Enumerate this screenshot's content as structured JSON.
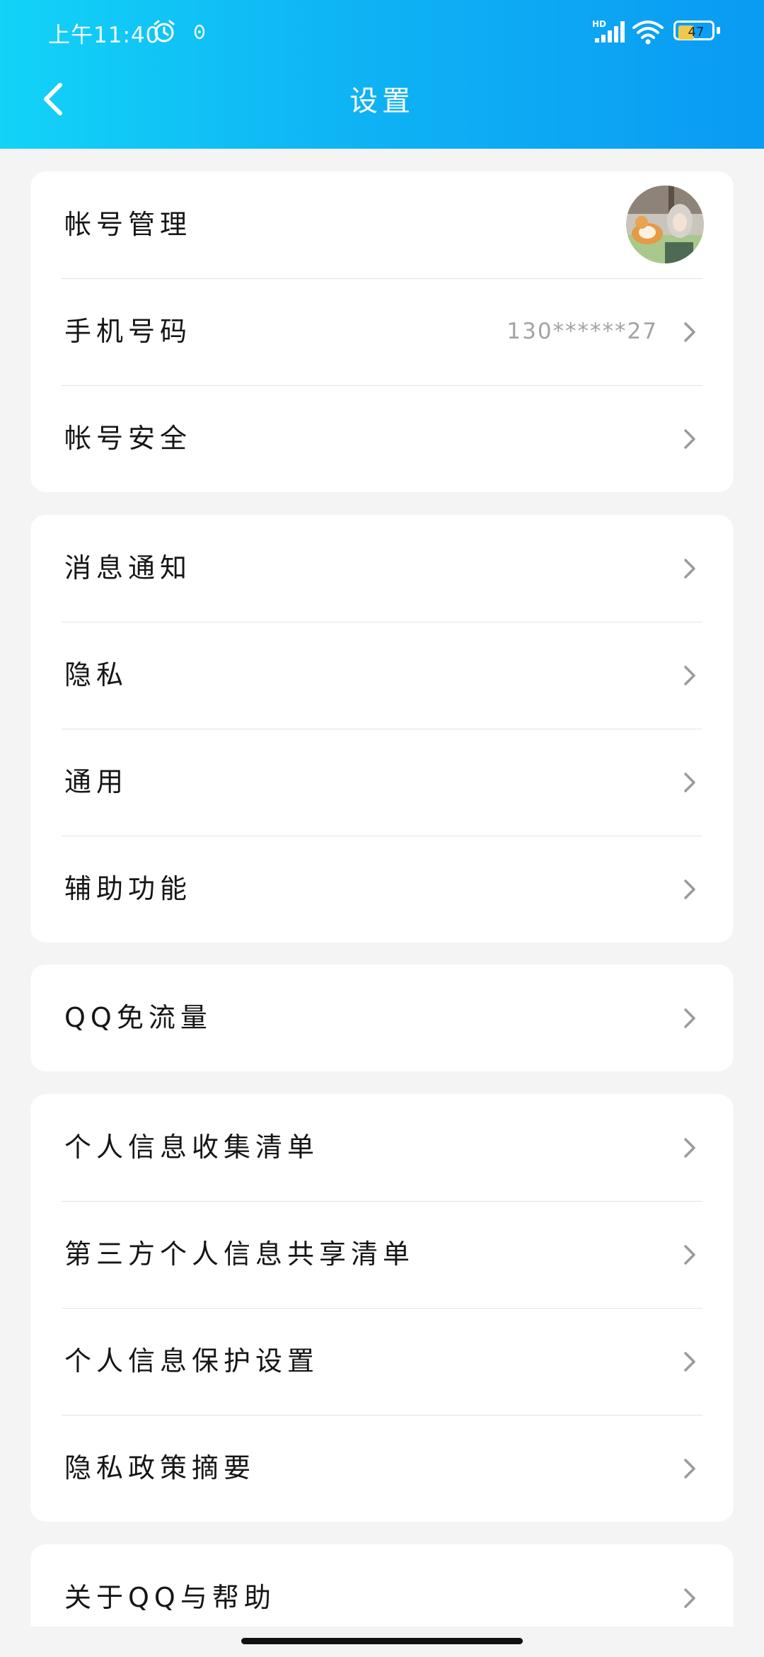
{
  "statusbar": {
    "time": "上午11:40",
    "battery_level": "47",
    "battery_percent": 47,
    "network_label": "HD"
  },
  "header": {
    "title": "设置",
    "back_icon": "chevron-left-icon"
  },
  "sections": [
    {
      "items": [
        {
          "label": "帐号管理",
          "has_avatar": true
        },
        {
          "label": "手机号码",
          "value": "130******27"
        },
        {
          "label": "帐号安全"
        }
      ]
    },
    {
      "items": [
        {
          "label": "消息通知"
        },
        {
          "label": "隐私"
        },
        {
          "label": "通用"
        },
        {
          "label": "辅助功能"
        }
      ]
    },
    {
      "items": [
        {
          "label": "QQ免流量"
        }
      ]
    },
    {
      "items": [
        {
          "label": "个人信息收集清单"
        },
        {
          "label": "第三方个人信息共享清单"
        },
        {
          "label": "个人信息保护设置"
        },
        {
          "label": "隐私政策摘要"
        }
      ]
    },
    {
      "items": [
        {
          "label": "关于QQ与帮助"
        }
      ]
    }
  ],
  "colors": {
    "header_gradient_start": "#12d3f8",
    "header_gradient_end": "#0a9bf3",
    "background": "#f4f4f4",
    "card": "#ffffff",
    "chevron": "#9a9a9a",
    "value_text": "#a3a3a3"
  }
}
